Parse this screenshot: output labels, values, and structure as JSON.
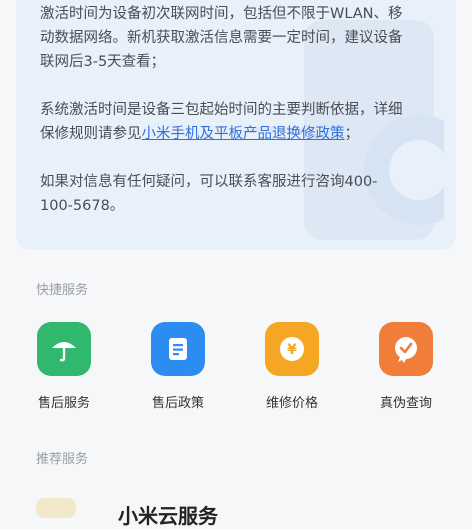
{
  "info": {
    "para1": "激活时间为设备初次联网时间，包括但不限于WLAN、移动数据网络。新机获取激活信息需要一定时间，建议设备联网后3-5天查看；",
    "para2_prefix": "系统激活时间是设备三包起始时间的主要判断依据，详细保修规则请参见",
    "para2_link": "小米手机及平板产品退换修政策",
    "para2_suffix": "；",
    "para3": "如果对信息有任何疑问，可以联系客服进行咨询400-100-5678。"
  },
  "quick_services": {
    "title": "快捷服务",
    "items": [
      {
        "label": "售后服务",
        "icon": "umbrella-icon",
        "color": "#2fb86e"
      },
      {
        "label": "售后政策",
        "icon": "document-icon",
        "color": "#2d8cf0"
      },
      {
        "label": "维修价格",
        "icon": "yen-coin-icon",
        "color": "#f5a623"
      },
      {
        "label": "真伪查询",
        "icon": "verified-badge-icon",
        "color": "#f07d3a"
      }
    ]
  },
  "recommended": {
    "title": "推荐服务",
    "first_item_title": "小米云服务"
  }
}
